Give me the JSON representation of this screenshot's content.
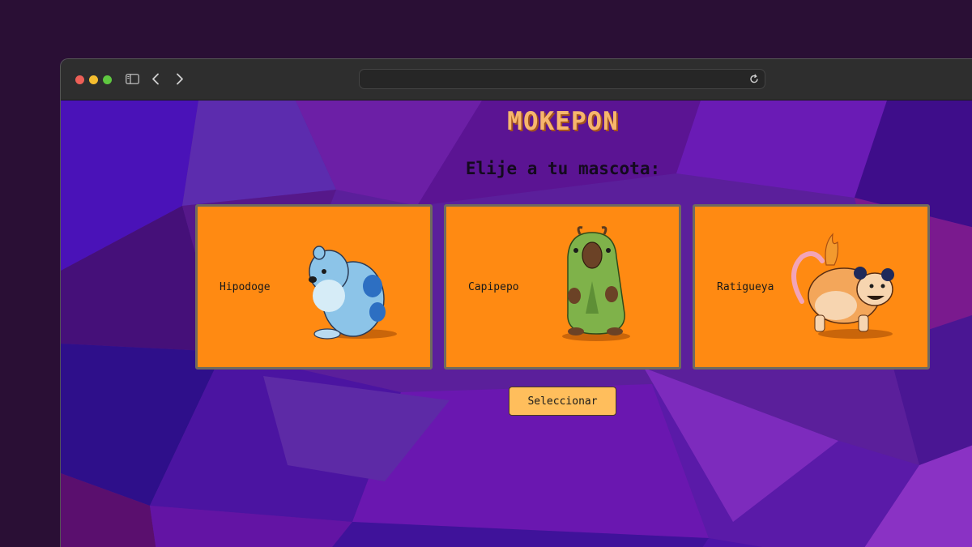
{
  "browser": {
    "url": "",
    "icons": {
      "close": "close-dot",
      "minimize": "minimize-dot",
      "maximize": "maximize-dot",
      "sidebar": "sidebar-icon",
      "back": "chevron-left-icon",
      "forward": "chevron-right-icon",
      "reload": "reload-icon"
    }
  },
  "page": {
    "title": "MOKEPON",
    "subtitle": "Elije a tu mascota:",
    "pets": [
      {
        "name": "Hipodoge",
        "color": "#8cc4e8"
      },
      {
        "name": "Capipepo",
        "color": "#7fb24a"
      },
      {
        "name": "Ratigueya",
        "color": "#f3a65a"
      }
    ],
    "select_button": "Seleccionar"
  },
  "colors": {
    "card_bg": "#ff8a12",
    "title": "#f6b66d",
    "button": "#ffbe5c",
    "background": "#5a1e9a"
  }
}
